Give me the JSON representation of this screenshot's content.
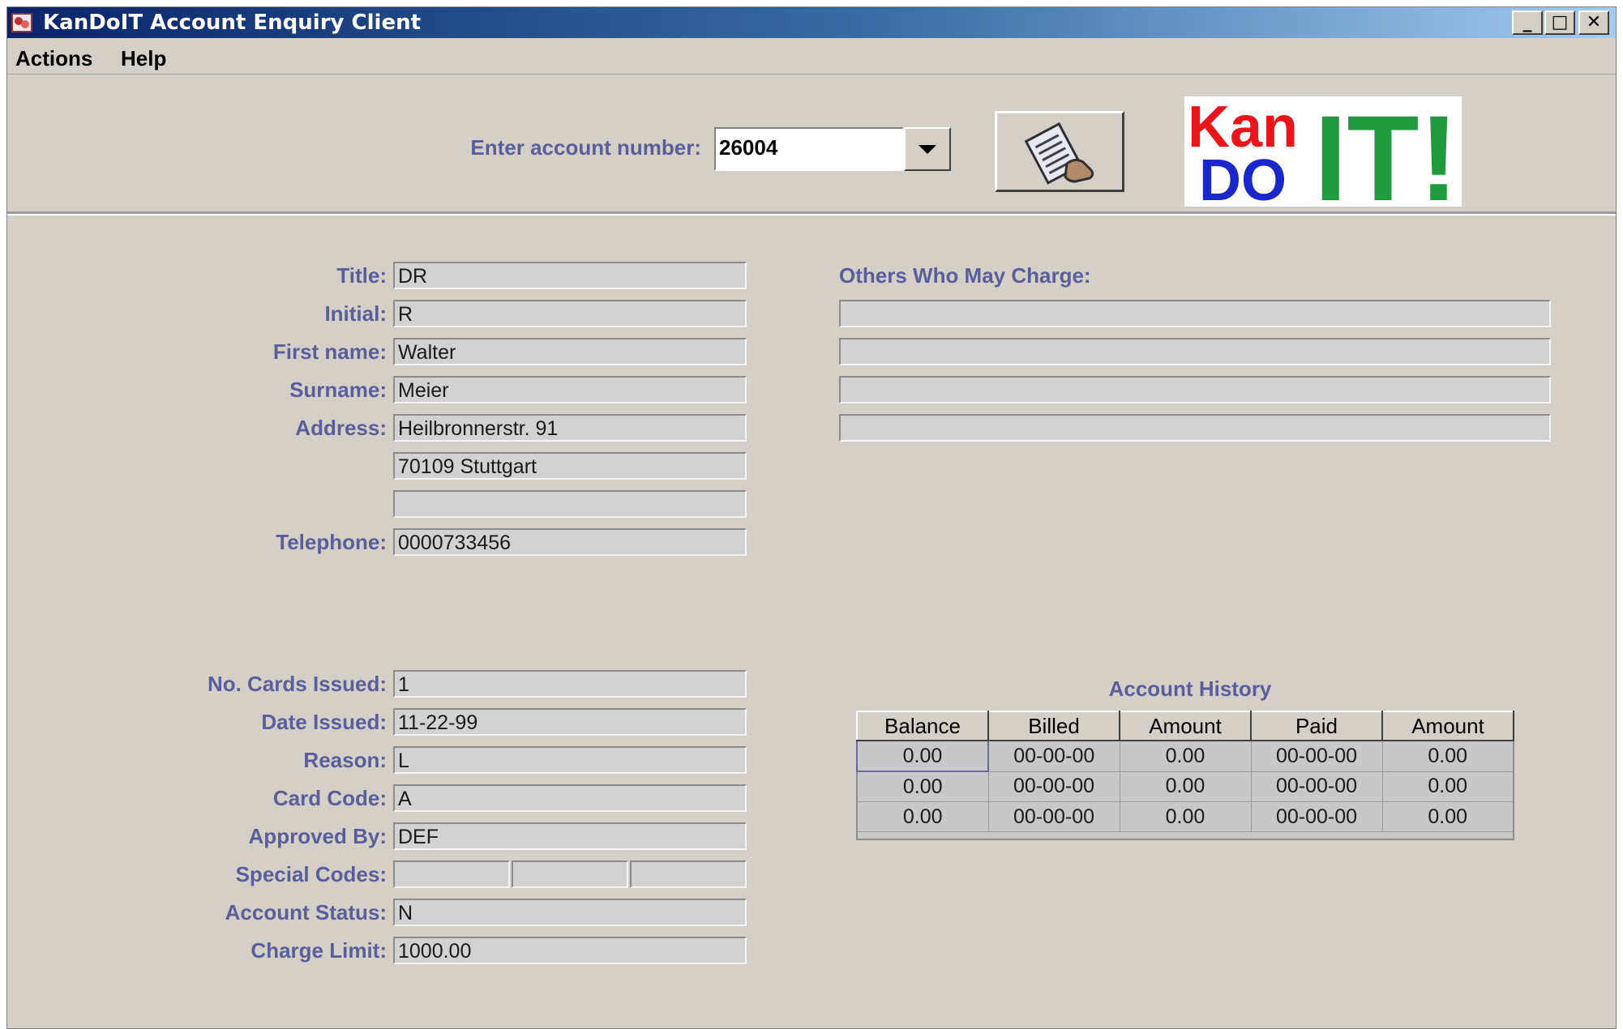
{
  "window": {
    "title": "KanDoIT Account Enquiry Client",
    "controls": {
      "minimize": "_",
      "maximize": "□",
      "close": "✕"
    }
  },
  "menu": [
    "Actions",
    "Help"
  ],
  "search": {
    "label": "Enter account number:",
    "value": "26004"
  },
  "logo": {
    "kan": "Kan",
    "do": "DO",
    "it": "IT!"
  },
  "customer": {
    "title_label": "Title:",
    "title": "DR",
    "initial_label": "Initial:",
    "initial": "R",
    "first_name_label": "First name:",
    "first_name": "Walter",
    "surname_label": "Surname:",
    "surname": "Meier",
    "address_label": "Address:",
    "address": [
      "Heilbronnerstr. 91",
      "70109 Stuttgart",
      ""
    ],
    "telephone_label": "Telephone:",
    "telephone": "0000733456"
  },
  "others": {
    "label": "Others Who May Charge:",
    "entries": [
      "",
      "",
      "",
      ""
    ]
  },
  "card": {
    "cards_issued_label": "No. Cards Issued:",
    "cards_issued": "1",
    "date_issued_label": "Date Issued:",
    "date_issued": "11-22-99",
    "reason_label": "Reason:",
    "reason": "L",
    "card_code_label": "Card Code:",
    "card_code": "A",
    "approved_by_label": "Approved By:",
    "approved_by": "DEF",
    "special_codes_label": "Special Codes:",
    "special_codes": [
      "",
      "",
      ""
    ],
    "account_status_label": "Account Status:",
    "account_status": "N",
    "charge_limit_label": "Charge Limit:",
    "charge_limit": "1000.00"
  },
  "history": {
    "title": "Account History",
    "columns": [
      "Balance",
      "Billed",
      "Amount",
      "Paid",
      "Amount"
    ],
    "rows": [
      [
        "0.00",
        "00-00-00",
        "0.00",
        "00-00-00",
        "0.00"
      ],
      [
        "0.00",
        "00-00-00",
        "0.00",
        "00-00-00",
        "0.00"
      ],
      [
        "0.00",
        "00-00-00",
        "0.00",
        "00-00-00",
        "0.00"
      ]
    ]
  }
}
